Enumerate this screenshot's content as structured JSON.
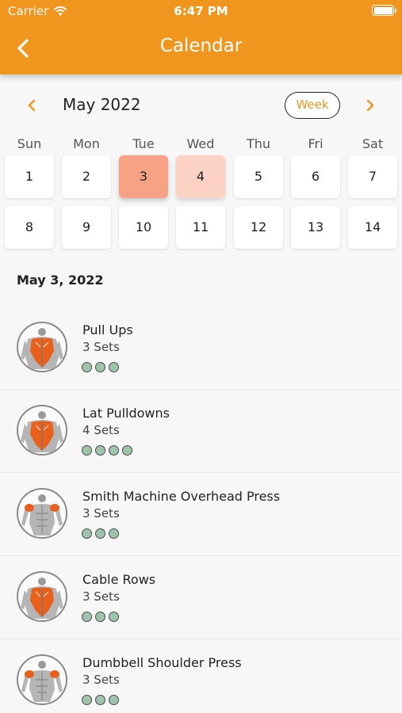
{
  "status": {
    "carrier": "Carrier",
    "time": "6:47 PM"
  },
  "header": {
    "title": "Calendar"
  },
  "calendar": {
    "month": "May 2022",
    "view_toggle": "Week",
    "weekdays": [
      "Sun",
      "Mon",
      "Tue",
      "Wed",
      "Thu",
      "Fri",
      "Sat"
    ],
    "weeks": [
      [
        "1",
        "2",
        "3",
        "4",
        "5",
        "6",
        "7"
      ],
      [
        "8",
        "9",
        "10",
        "11",
        "12",
        "13",
        "14"
      ]
    ],
    "selected_day": "3",
    "highlighted_day": "4"
  },
  "selected_date": "May 3, 2022",
  "exercises": [
    {
      "name": "Pull Ups",
      "sets_label": "3 Sets",
      "sets": 3,
      "muscle": "back"
    },
    {
      "name": "Lat Pulldowns",
      "sets_label": "4 Sets",
      "sets": 4,
      "muscle": "back"
    },
    {
      "name": "Smith Machine Overhead Press",
      "sets_label": "3 Sets",
      "sets": 3,
      "muscle": "shoulders"
    },
    {
      "name": "Cable Rows",
      "sets_label": "3 Sets",
      "sets": 3,
      "muscle": "back"
    },
    {
      "name": "Dumbbell Shoulder Press",
      "sets_label": "3 Sets",
      "sets": 3,
      "muscle": "shoulders"
    }
  ],
  "colors": {
    "accent": "#f0961f",
    "selected_day": "#f7a185",
    "highlighted_day": "#fbd2c4",
    "set_dot": "#9fc4ab",
    "muscle": "#e8601c"
  }
}
